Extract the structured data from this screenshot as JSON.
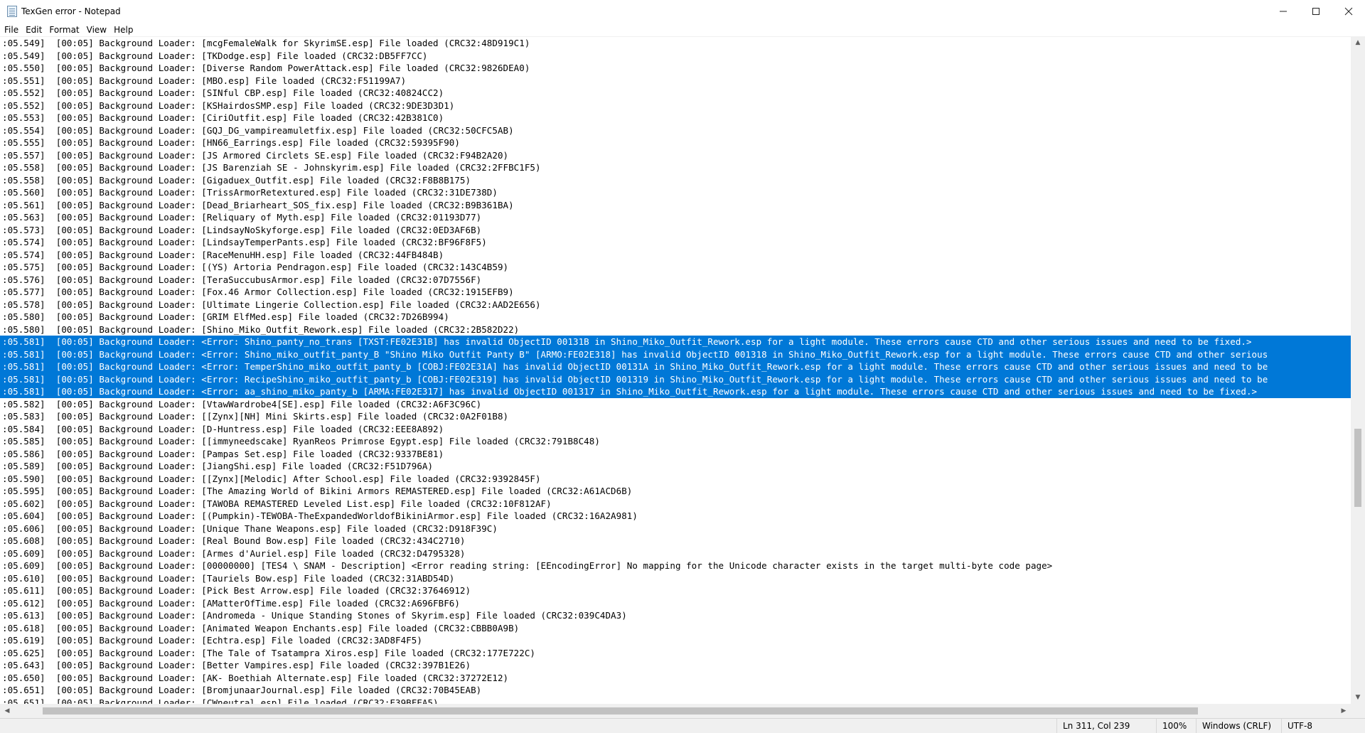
{
  "window": {
    "title": "TexGen error - Notepad"
  },
  "menu": [
    "File",
    "Edit",
    "Format",
    "View",
    "Help"
  ],
  "lines": [
    ":05.549]  [00:05] Background Loader: [mcgFemaleWalk for SkyrimSE.esp] File loaded (CRC32:48D919C1)",
    ":05.549]  [00:05] Background Loader: [TKDodge.esp] File loaded (CRC32:DB5FF7CC)",
    ":05.550]  [00:05] Background Loader: [Diverse Random PowerAttack.esp] File loaded (CRC32:9826DEA0)",
    ":05.551]  [00:05] Background Loader: [MBO.esp] File loaded (CRC32:F51199A7)",
    ":05.552]  [00:05] Background Loader: [SINful CBP.esp] File loaded (CRC32:40824CC2)",
    ":05.552]  [00:05] Background Loader: [KSHairdosSMP.esp] File loaded (CRC32:9DE3D3D1)",
    ":05.553]  [00:05] Background Loader: [CiriOutfit.esp] File loaded (CRC32:42B381C0)",
    ":05.554]  [00:05] Background Loader: [GQJ_DG_vampireamuletfix.esp] File loaded (CRC32:50CFC5AB)",
    ":05.555]  [00:05] Background Loader: [HN66_Earrings.esp] File loaded (CRC32:59395F90)",
    ":05.557]  [00:05] Background Loader: [JS Armored Circlets SE.esp] File loaded (CRC32:F94B2A20)",
    ":05.558]  [00:05] Background Loader: [JS Barenziah SE - Johnskyrim.esp] File loaded (CRC32:2FFBC1F5)",
    ":05.558]  [00:05] Background Loader: [Gigaduex_Outfit.esp] File loaded (CRC32:F8B8B175)",
    ":05.560]  [00:05] Background Loader: [TrissArmorRetextured.esp] File loaded (CRC32:31DE738D)",
    ":05.561]  [00:05] Background Loader: [Dead_Briarheart_SOS_fix.esp] File loaded (CRC32:B9B361BA)",
    ":05.563]  [00:05] Background Loader: [Reliquary of Myth.esp] File loaded (CRC32:01193D77)",
    ":05.573]  [00:05] Background Loader: [LindsayNoSkyforge.esp] File loaded (CRC32:0ED3AF6B)",
    ":05.574]  [00:05] Background Loader: [LindsayTemperPants.esp] File loaded (CRC32:BF96F8F5)",
    ":05.574]  [00:05] Background Loader: [RaceMenuHH.esp] File loaded (CRC32:44FB484B)",
    ":05.575]  [00:05] Background Loader: [(YS) Artoria Pendragon.esp] File loaded (CRC32:143C4B59)",
    ":05.576]  [00:05] Background Loader: [TeraSuccubusArmor.esp] File loaded (CRC32:07D7556F)",
    ":05.577]  [00:05] Background Loader: [Fox.46 Armor Collection.esp] File loaded (CRC32:1915EFB9)",
    ":05.578]  [00:05] Background Loader: [Ultimate Lingerie Collection.esp] File loaded (CRC32:AAD2E656)",
    ":05.580]  [00:05] Background Loader: [GRIM ElfMed.esp] File loaded (CRC32:7D26B994)",
    ":05.580]  [00:05] Background Loader: [Shino_Miko_Outfit_Rework.esp] File loaded (CRC32:2B582D22)",
    ":05.581]  [00:05] Background Loader: <Error: Shino_panty_no_trans [TXST:FE02E31B] has invalid ObjectID 00131B in Shino_Miko_Outfit_Rework.esp for a light module. These errors cause CTD and other serious issues and need to be fixed.>",
    ":05.581]  [00:05] Background Loader: <Error: Shino_miko_outfit_panty_B \"Shino Miko Outfit Panty B\" [ARMO:FE02E318] has invalid ObjectID 001318 in Shino_Miko_Outfit_Rework.esp for a light module. These errors cause CTD and other serious",
    ":05.581]  [00:05] Background Loader: <Error: TemperShino_miko_outfit_panty_b [COBJ:FE02E31A] has invalid ObjectID 00131A in Shino_Miko_Outfit_Rework.esp for a light module. These errors cause CTD and other serious issues and need to be",
    ":05.581]  [00:05] Background Loader: <Error: RecipeShino_miko_outfit_panty_b [COBJ:FE02E319] has invalid ObjectID 001319 in Shino_Miko_Outfit_Rework.esp for a light module. These errors cause CTD and other serious issues and need to be",
    ":05.581]  [00:05] Background Loader: <Error: aa_shino_miko_panty_b [ARMA:FE02E317] has invalid ObjectID 001317 in Shino_Miko_Outfit_Rework.esp for a light module. These errors cause CTD and other serious issues and need to be fixed.>",
    ":05.582]  [00:05] Background Loader: [VtawWardrobe4[SE].esp] File loaded (CRC32:A6F3C96C)",
    ":05.583]  [00:05] Background Loader: [[Zynx][NH] Mini Skirts.esp] File loaded (CRC32:0A2F01B8)",
    ":05.584]  [00:05] Background Loader: [D-Huntress.esp] File loaded (CRC32:EEE8A892)",
    ":05.585]  [00:05] Background Loader: [[immyneedscake] RyanReos Primrose Egypt.esp] File loaded (CRC32:791B8C48)",
    ":05.586]  [00:05] Background Loader: [Pampas Set.esp] File loaded (CRC32:9337BE81)",
    ":05.589]  [00:05] Background Loader: [JiangShi.esp] File loaded (CRC32:F51D796A)",
    ":05.590]  [00:05] Background Loader: [[Zynx][Melodic] After School.esp] File loaded (CRC32:9392845F)",
    ":05.595]  [00:05] Background Loader: [The Amazing World of Bikini Armors REMASTERED.esp] File loaded (CRC32:A61ACD6B)",
    ":05.602]  [00:05] Background Loader: [TAWOBA REMASTERED Leveled List.esp] File loaded (CRC32:10F812AF)",
    ":05.604]  [00:05] Background Loader: [(Pumpkin)-TEWOBA-TheExpandedWorldofBikiniArmor.esp] File loaded (CRC32:16A2A981)",
    ":05.606]  [00:05] Background Loader: [Unique Thane Weapons.esp] File loaded (CRC32:D918F39C)",
    ":05.608]  [00:05] Background Loader: [Real Bound Bow.esp] File loaded (CRC32:434C2710)",
    ":05.609]  [00:05] Background Loader: [Armes d'Auriel.esp] File loaded (CRC32:D4795328)",
    ":05.609]  [00:05] Background Loader: [00000000] [TES4 \\ SNAM - Description] <Error reading string: [EEncodingError] No mapping for the Unicode character exists in the target multi-byte code page>",
    ":05.610]  [00:05] Background Loader: [Tauriels Bow.esp] File loaded (CRC32:31ABD54D)",
    ":05.611]  [00:05] Background Loader: [Pick Best Arrow.esp] File loaded (CRC32:37646912)",
    ":05.612]  [00:05] Background Loader: [AMatterOfTime.esp] File loaded (CRC32:A696FBF6)",
    ":05.613]  [00:05] Background Loader: [Andromeda - Unique Standing Stones of Skyrim.esp] File loaded (CRC32:039C4DA3)",
    ":05.618]  [00:05] Background Loader: [Animated Weapon Enchants.esp] File loaded (CRC32:CBBB0A9B)",
    ":05.619]  [00:05] Background Loader: [Echtra.esp] File loaded (CRC32:3AD8F4F5)",
    ":05.625]  [00:05] Background Loader: [The Tale of Tsatampra Xiros.esp] File loaded (CRC32:177E722C)",
    ":05.643]  [00:05] Background Loader: [Better Vampires.esp] File loaded (CRC32:397B1E26)",
    ":05.650]  [00:05] Background Loader: [AK- Boethiah Alternate.esp] File loaded (CRC32:37272E12)",
    ":05.651]  [00:05] Background Loader: [BromjunaarJournal.esp] File loaded (CRC32:70B45EAB)",
    ":05.651]  [00:05] Background Loader: [CWneutral.esp] File loaded (CRC32:E39BFEA5)"
  ],
  "selected_lines": [
    24,
    25,
    26,
    27,
    28
  ],
  "status": {
    "position": "Ln 311, Col 239",
    "zoom": "100%",
    "line_ending": "Windows (CRLF)",
    "encoding": "UTF-8"
  },
  "colors": {
    "selection": "#0078d7"
  }
}
